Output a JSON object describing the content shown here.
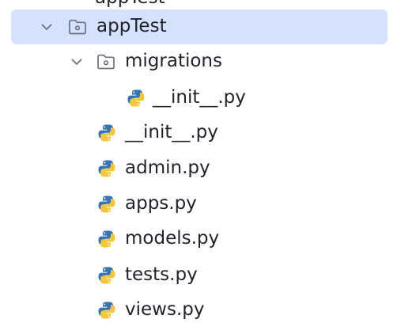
{
  "tree": {
    "partial_top_label": "appTest",
    "nodes": [
      {
        "label": "appTest",
        "type": "folder",
        "expanded": true,
        "selected": true
      },
      {
        "label": "migrations",
        "type": "folder",
        "expanded": true,
        "selected": false
      },
      {
        "label": "__init__.py",
        "type": "python-file",
        "selected": false
      },
      {
        "label": "__init__.py",
        "type": "python-file",
        "selected": false
      },
      {
        "label": "admin.py",
        "type": "python-file",
        "selected": false
      },
      {
        "label": "apps.py",
        "type": "python-file",
        "selected": false
      },
      {
        "label": "models.py",
        "type": "python-file",
        "selected": false
      },
      {
        "label": "tests.py",
        "type": "python-file",
        "selected": false
      },
      {
        "label": "views.py",
        "type": "python-file",
        "selected": false
      }
    ]
  },
  "colors": {
    "selection": "#d5e1ff",
    "text": "#1f2329",
    "chevron": "#6c707e",
    "folder": "#6c707e",
    "python_blue": "#3873b3",
    "python_yellow": "#f2c73b"
  }
}
